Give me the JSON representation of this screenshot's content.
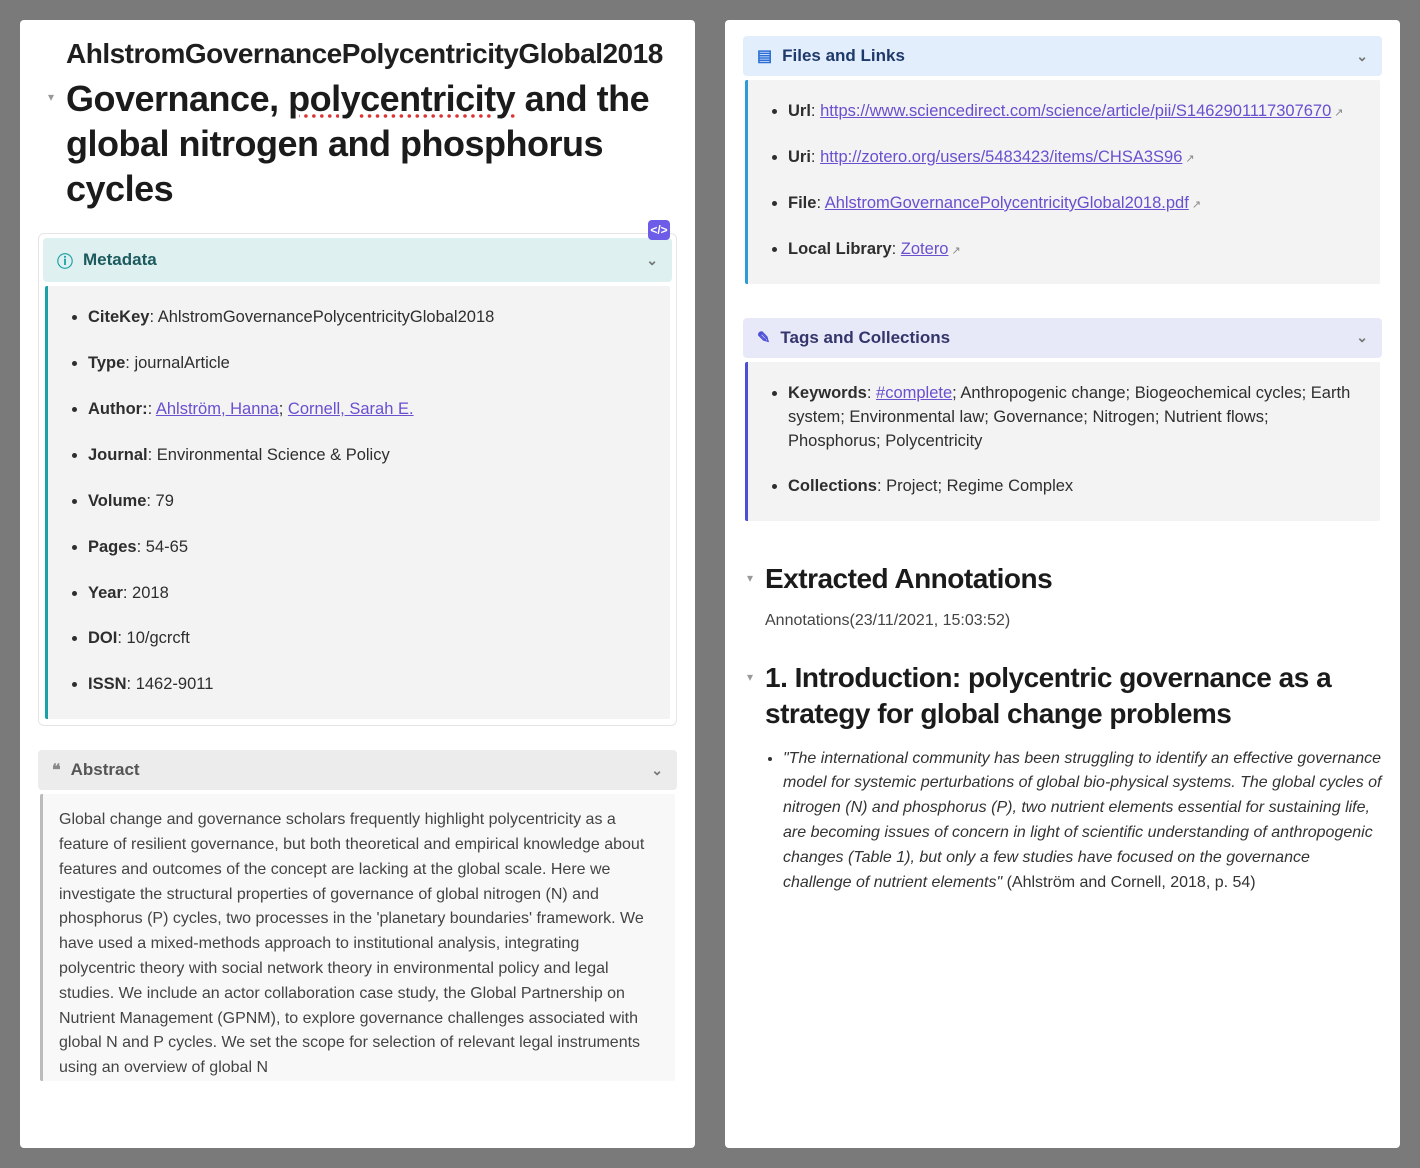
{
  "breadcrumb": "AhlstromGovernancePolycentricityGlobal2018",
  "title_parts": {
    "pre": "Governance, ",
    "spell": "polycentricity",
    "post": " and the global nitrogen and phosphorus cycles"
  },
  "callouts": {
    "metadata": {
      "title": "Metadata"
    },
    "abstract": {
      "title": "Abstract"
    },
    "files": {
      "title": "Files and Links"
    },
    "tags": {
      "title": "Tags and Collections"
    }
  },
  "metadata": {
    "citekey_k": "CiteKey",
    "citekey_v": "AhlstromGovernancePolycentricityGlobal2018",
    "type_k": "Type",
    "type_v": "journalArticle",
    "author_k": "Author:",
    "author1": "Ahlström, Hanna",
    "author_sep": "; ",
    "author2": "Cornell, Sarah E.",
    "journal_k": "Journal",
    "journal_v": "Environmental Science & Policy",
    "volume_k": "Volume",
    "volume_v": "79",
    "pages_k": "Pages",
    "pages_v": "54-65",
    "year_k": "Year",
    "year_v": "2018",
    "doi_k": "DOI",
    "doi_v": "10/gcrcft",
    "issn_k": "ISSN",
    "issn_v": "1462-9011"
  },
  "abstract": "Global change and governance scholars frequently highlight polycentricity as a feature of resilient governance, but both theoretical and empirical knowledge about features and outcomes of the concept are lacking at the global scale. Here we investigate the structural properties of governance of global nitrogen (N) and phosphorus (P) cycles, two processes in the 'planetary boundaries' framework. We have used a mixed-methods approach to institutional analysis, integrating polycentric theory with social network theory in environmental policy and legal studies. We include an actor collaboration case study, the Global Partnership on Nutrient Management (GPNM), to explore governance challenges associated with global N and P cycles. We set the scope for selection of relevant legal instruments using an overview of global N",
  "files": {
    "url_k": "Url",
    "url_v": "https://www.sciencedirect.com/science/article/pii/S1462901117307670",
    "uri_k": "Uri",
    "uri_v": "http://zotero.org/users/5483423/items/CHSA3S96",
    "file_k": "File",
    "file_v": "AhlstromGovernancePolycentricityGlobal2018.pdf",
    "lib_k": "Local Library",
    "lib_v": "Zotero"
  },
  "tags": {
    "kw_k": "Keywords",
    "kw_tag": "#complete",
    "kw_rest": "; Anthropogenic change; Biogeochemical cycles; Earth system; Environmental law; Governance; Nitrogen; Nutrient flows; Phosphorus; Polycentricity",
    "coll_k": "Collections",
    "coll_v": "Project; Regime Complex"
  },
  "right": {
    "h_extracted": "Extracted Annotations",
    "annot_meta": "Annotations(23/11/2021, 15:03:52)",
    "h_intro": "1. Introduction: polycentric governance as a strategy for global change problems",
    "quote": "\"The international community has been struggling to identify an effective governance model for systemic perturbations of global bio-physical systems. The global cycles of nitrogen (N) and phosphorus (P), two nutrient elements essential for sustaining life, are becoming issues of concern in light of scientific understanding of anthropogenic changes (Table 1), but only a few studies have focused on the governance challenge of nutrient elements\"",
    "cite": " (Ahlström and Cornell, 2018, p. 54)"
  }
}
